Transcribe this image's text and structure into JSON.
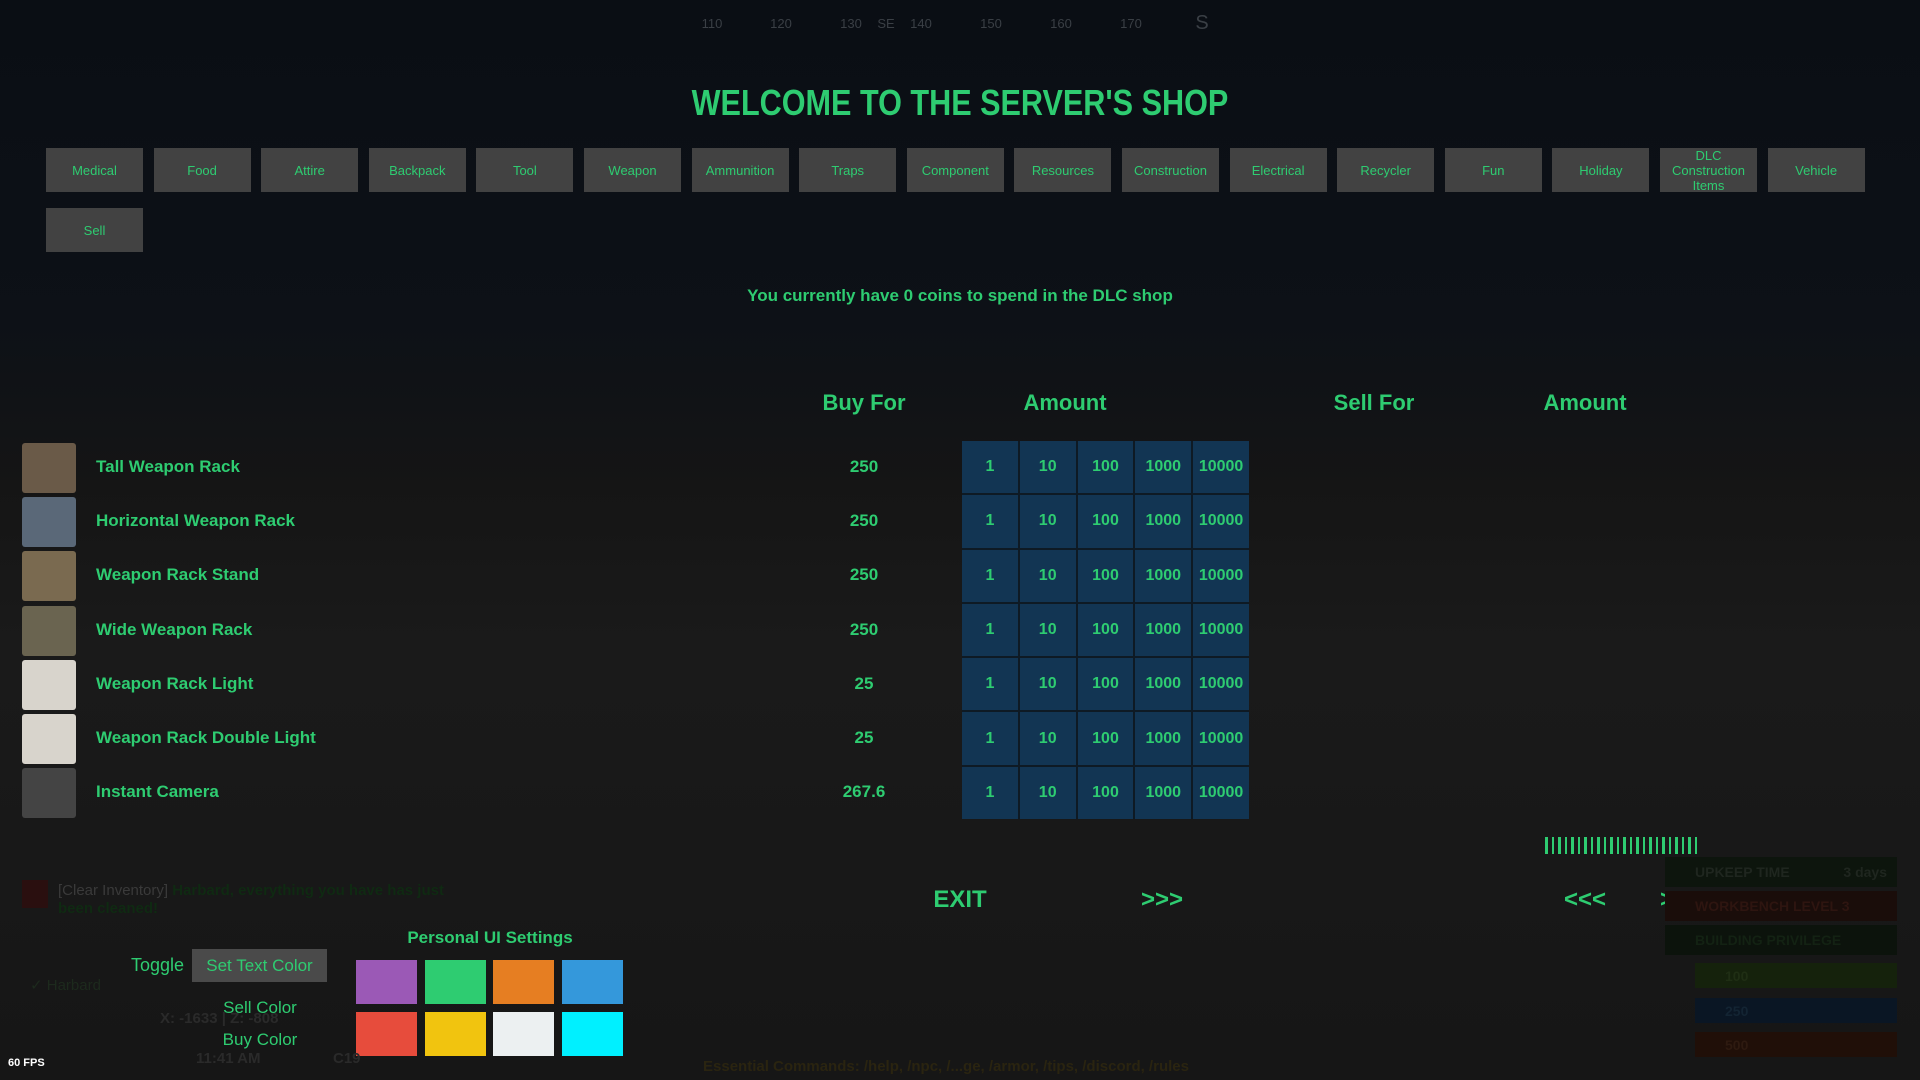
{
  "compass": {
    "ticks": [
      "110",
      "120",
      "130",
      "SE",
      "140",
      "150",
      "160",
      "170",
      "S"
    ]
  },
  "title": "WELCOME TO THE SERVER'S SHOP",
  "categories": [
    "Medical",
    "Food",
    "Attire",
    "Backpack",
    "Tool",
    "Weapon",
    "Ammunition",
    "Traps",
    "Component",
    "Resources",
    "Construction",
    "Electrical",
    "Recycler",
    "Fun",
    "Holiday",
    "DLC Construction Items",
    "Vehicle",
    "Sell"
  ],
  "coins_text": "You currently have 0 coins to spend in the DLC shop",
  "headers": {
    "buy_for": "Buy For",
    "amount": "Amount",
    "sell_for": "Sell For",
    "sell_amount": "Amount"
  },
  "amount_options": [
    "1",
    "10",
    "100",
    "1000",
    "10000"
  ],
  "items": [
    {
      "name": "Tall Weapon Rack",
      "buy": "250",
      "icon": "tall-weapon-rack-icon"
    },
    {
      "name": "Horizontal Weapon Rack",
      "buy": "250",
      "icon": "horizontal-weapon-rack-icon"
    },
    {
      "name": "Weapon Rack Stand",
      "buy": "250",
      "icon": "weapon-rack-stand-icon"
    },
    {
      "name": "Wide Weapon Rack",
      "buy": "250",
      "icon": "wide-weapon-rack-icon"
    },
    {
      "name": "Weapon Rack Light",
      "buy": "25",
      "icon": "weapon-rack-light-icon"
    },
    {
      "name": "Weapon Rack Double Light",
      "buy": "25",
      "icon": "weapon-rack-double-light-icon"
    },
    {
      "name": "Instant Camera",
      "buy": "267.6",
      "icon": "instant-camera-icon"
    }
  ],
  "nav": {
    "exit": "EXIT",
    "next": ">>>",
    "sell_prev": "<<<",
    "sell_next": ">>>"
  },
  "settings": {
    "title": "Personal UI Settings",
    "toggle": "Toggle",
    "set_text_color": "Set Text Color",
    "sell_color": "Sell Color",
    "buy_color": "Buy Color",
    "swatches": [
      "#9b59b6",
      "#2ecc71",
      "#e67e22",
      "#3498db",
      "#e74c3c",
      "#f1c40f",
      "#ecf0f1",
      "#00f0ff"
    ]
  },
  "accent": "#2ecc71",
  "fps": "60 FPS",
  "background_hud": {
    "chat_tag": "[Clear Inventory]",
    "chat_msg": "Harbard, everything you have has just been cleaned!",
    "player": "✓ Harbard",
    "coords": "X: -1633 | Z: -808",
    "time": "11:41 AM",
    "grid": "C19",
    "commands": "Essential Commands: /help, /npc, /...ge, /armor, /tips, /discord, /rules",
    "upkeep": "UPKEEP TIME",
    "upkeep_val": "3 days",
    "workbench": "WORKBENCH LEVEL 3",
    "privilege": "BUILDING PRIVILEGE",
    "health": "100",
    "water": "250",
    "food": "500"
  }
}
